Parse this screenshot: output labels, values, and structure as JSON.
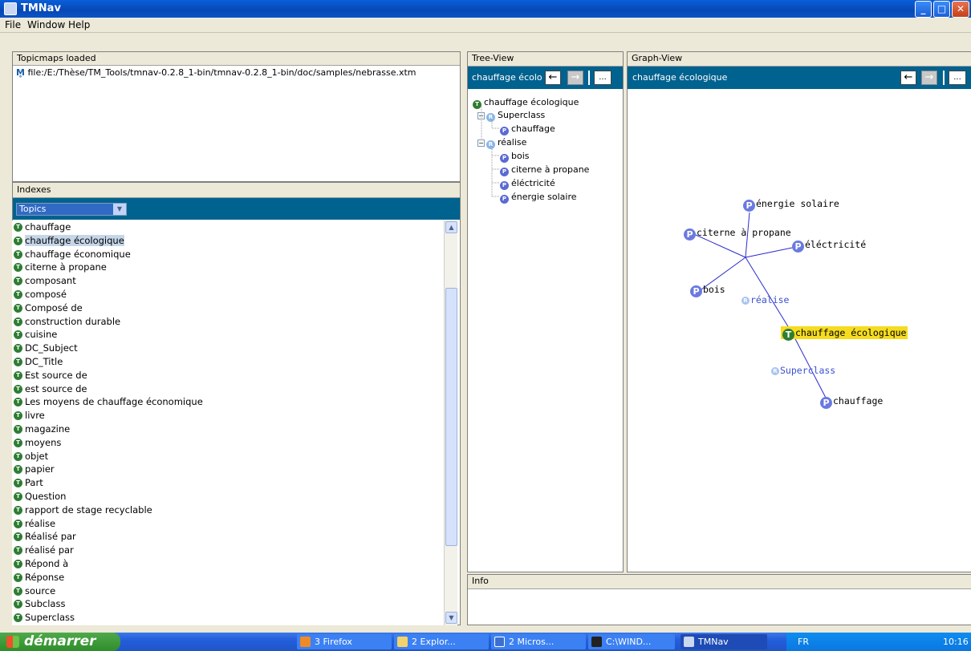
{
  "window": {
    "title": "TMNav"
  },
  "menu": [
    "File",
    "Window",
    "Help"
  ],
  "topicmaps": {
    "header": "Topicmaps loaded",
    "file": "file:/E:/Thèse/TM_Tools/tmnav-0.2.8_1-bin/tmnav-0.2.8_1-bin/doc/samples/nebrasse.xtm"
  },
  "indexes": {
    "header": "Indexes",
    "dropdown_value": "Topics",
    "items": [
      "chauffage",
      "chauffage écologique",
      "chauffage économique",
      "citerne à propane",
      "composant",
      "composé",
      "Composé de",
      "construction durable",
      "cuisine",
      "DC_Subject",
      "DC_Title",
      "Est source de",
      "est source de",
      "Les moyens de chauffage économique",
      "livre",
      "magazine",
      "moyens",
      "objet",
      "papier",
      "Part",
      "Question",
      "rapport de stage recyclable",
      "réalise",
      "Réalisé par",
      "réalisé par",
      "Répond à",
      "Réponse",
      "source",
      "Subclass",
      "Superclass"
    ],
    "selected": "chauffage écologique"
  },
  "tree_view": {
    "header": "Tree-View",
    "bar_text": "chauffage écolo",
    "root": "chauffage écologique",
    "superclass": "Superclass",
    "superclass_children": [
      "chauffage"
    ],
    "realise": "réalise",
    "realise_children": [
      "bois",
      "citerne à propane",
      "éléctricité",
      "énergie solaire"
    ]
  },
  "graph_view": {
    "header": "Graph-View",
    "bar_text": "chauffage écologique",
    "nodes": {
      "energie": "énergie solaire",
      "citerne": "citerne à propane",
      "electricite": "éléctricité",
      "bois": "bois",
      "realise": "réalise",
      "center": "chauffage écologique",
      "superclass": "Superclass",
      "chauffage": "chauffage"
    }
  },
  "info": {
    "header": "Info"
  },
  "taskbar": {
    "start": "démarrer",
    "items": [
      "3 Firefox",
      "2 Explor...",
      "2 Micros...",
      "C:\\WIND...",
      "TMNav"
    ],
    "lang": "FR",
    "time": "10:16"
  },
  "icons": {
    "topic": "T",
    "occurrence": "P",
    "role": "R",
    "ellipsis": "...",
    "back": "←",
    "forward": "→"
  }
}
